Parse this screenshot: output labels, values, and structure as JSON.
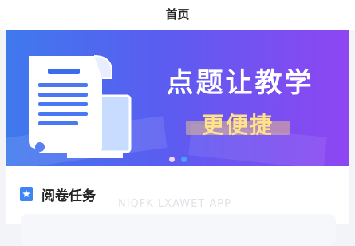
{
  "header": {
    "title": "首页"
  },
  "banner": {
    "headline": "点题让教学",
    "subline": "更便捷",
    "carousel": {
      "count": 2,
      "active_index": 0
    }
  },
  "section": {
    "icon": "star-badge-icon",
    "title": "阅卷任务",
    "watermark": "NIQFK LXAWET APP"
  },
  "colors": {
    "banner_start": "#3f79ee",
    "banner_end": "#8e46f2",
    "accent_yellow": "#ffe28a",
    "section_icon": "#3e86f5"
  }
}
